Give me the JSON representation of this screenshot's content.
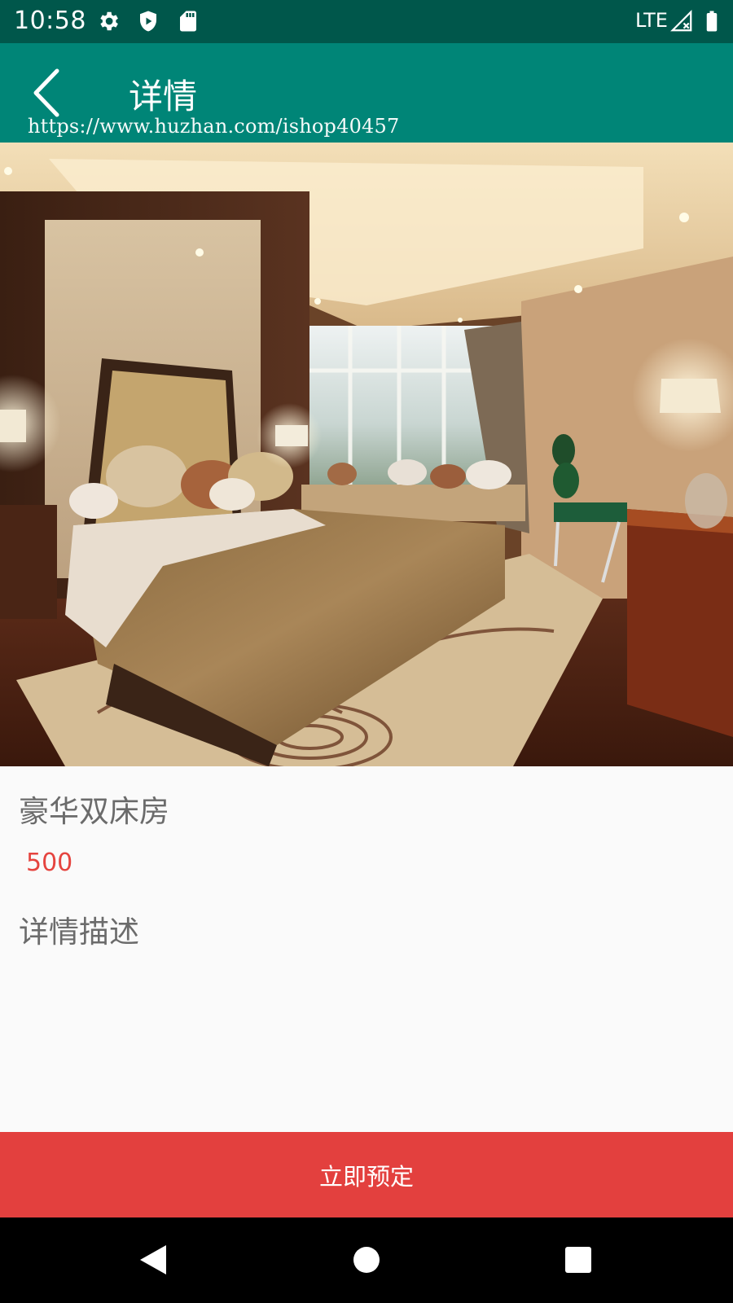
{
  "status_bar": {
    "time": "10:58",
    "network": "LTE",
    "icons": [
      "settings-icon",
      "shield-play-icon",
      "sd-card-icon",
      "signal-icon",
      "battery-icon"
    ]
  },
  "app_bar": {
    "title": "详情",
    "watermark": "https://www.huzhan.com/ishop40457",
    "background_color": "#008577"
  },
  "room": {
    "name": "豪华双床房",
    "price": "500",
    "description_title": "详情描述"
  },
  "actions": {
    "book_label": "立即预定",
    "book_color": "#e3403e"
  },
  "nav_bar": {
    "icons": [
      "back-triangle-icon",
      "home-circle-icon",
      "recents-square-icon"
    ]
  }
}
